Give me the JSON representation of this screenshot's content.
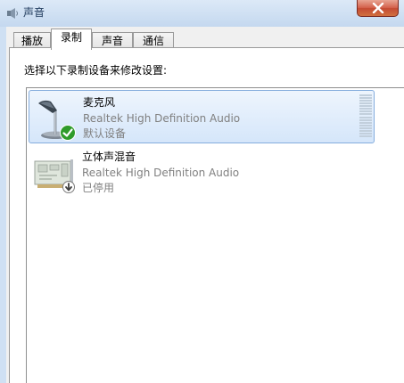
{
  "window": {
    "title": "声音",
    "icons": {
      "app": "speaker-icon",
      "close": "close-icon"
    }
  },
  "tabs": [
    {
      "label": "播放",
      "active": false
    },
    {
      "label": "录制",
      "active": true
    },
    {
      "label": "声音",
      "active": false
    },
    {
      "label": "通信",
      "active": false
    }
  ],
  "instruction": "选择以下录制设备来修改设置:",
  "devices": [
    {
      "name": "麦克风",
      "description": "Realtek High Definition Audio",
      "status": "默认设备",
      "icon": "microphone-icon",
      "badge": "default-checkmark-icon",
      "selected": true,
      "level_meter_segments": 16
    },
    {
      "name": "立体声混音",
      "description": "Realtek High Definition Audio",
      "status": "已停用",
      "icon": "sound-card-icon",
      "badge": "disabled-arrow-icon",
      "selected": false
    }
  ],
  "colors": {
    "selection_border": "#84acdd",
    "selection_fill": "#d5e6fa",
    "close_button": "#c44a33"
  }
}
